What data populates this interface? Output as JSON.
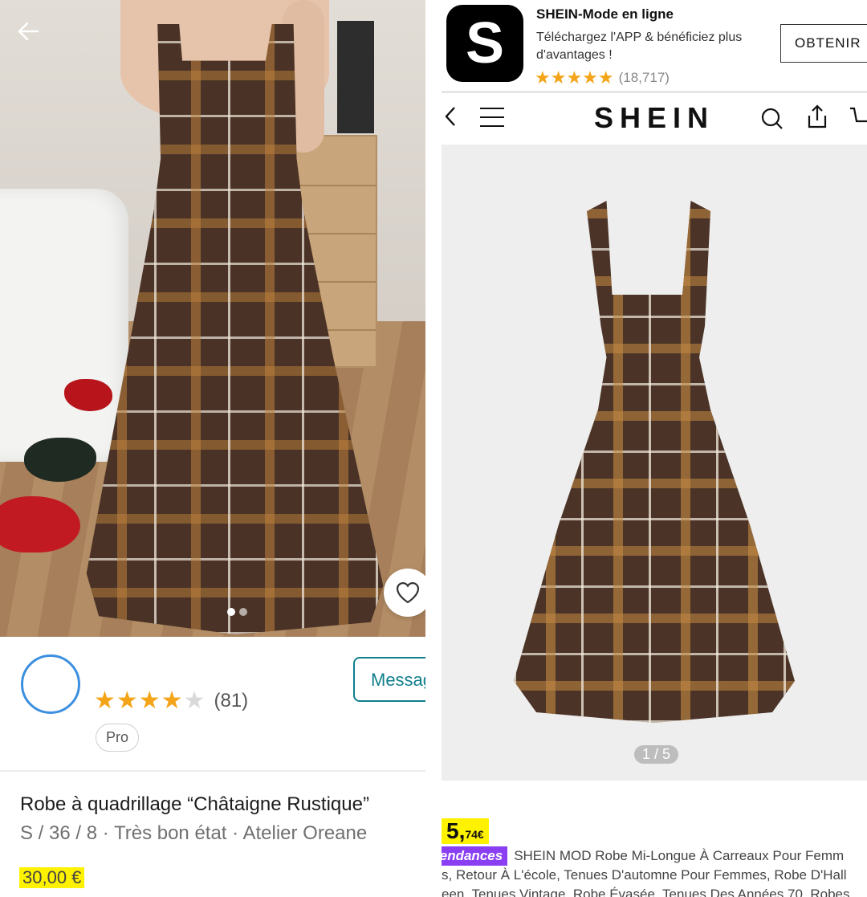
{
  "left": {
    "seller": {
      "rating_stars": "★★★★★",
      "rating_count": "(81)",
      "badge": "Pro",
      "message_button": "Messag"
    },
    "item": {
      "title": "Robe à quadrillage “Châtaigne Rustique”",
      "subtitle": "S / 36 / 8 · Très bon état · Atelier Oreane",
      "price": "30,00 €"
    }
  },
  "right": {
    "banner": {
      "app_icon_letter": "S",
      "app_name": "SHEIN-Mode en ligne",
      "app_description": "Téléchargez l'APP & bénéficiez plus d'avantages !",
      "rating_stars": "★★★★★",
      "rating_count": "(18,717)",
      "get_button": "OBTENIR"
    },
    "nav": {
      "back": "‹",
      "logo": "SHEIN"
    },
    "image_counter": "1 / 5",
    "price_main": "5,",
    "price_cents": "74€",
    "trend_tag": "Tendances",
    "description_line1": "SHEIN MOD Robe Mi-Longue À Carreaux Pour Femm",
    "description_line2": "s, Retour À L'école, Tenues D'automne Pour Femmes, Robe D'Hall",
    "description_line3": "een, Tenues Vintage, Robe Évasée, Tenues Des Années 70, Robes"
  },
  "colors": {
    "rating_star": "#f4a418",
    "highlight": "#fff200",
    "vinted_teal": "#0f7f8c",
    "trend_purple": "#8a3ff2"
  }
}
